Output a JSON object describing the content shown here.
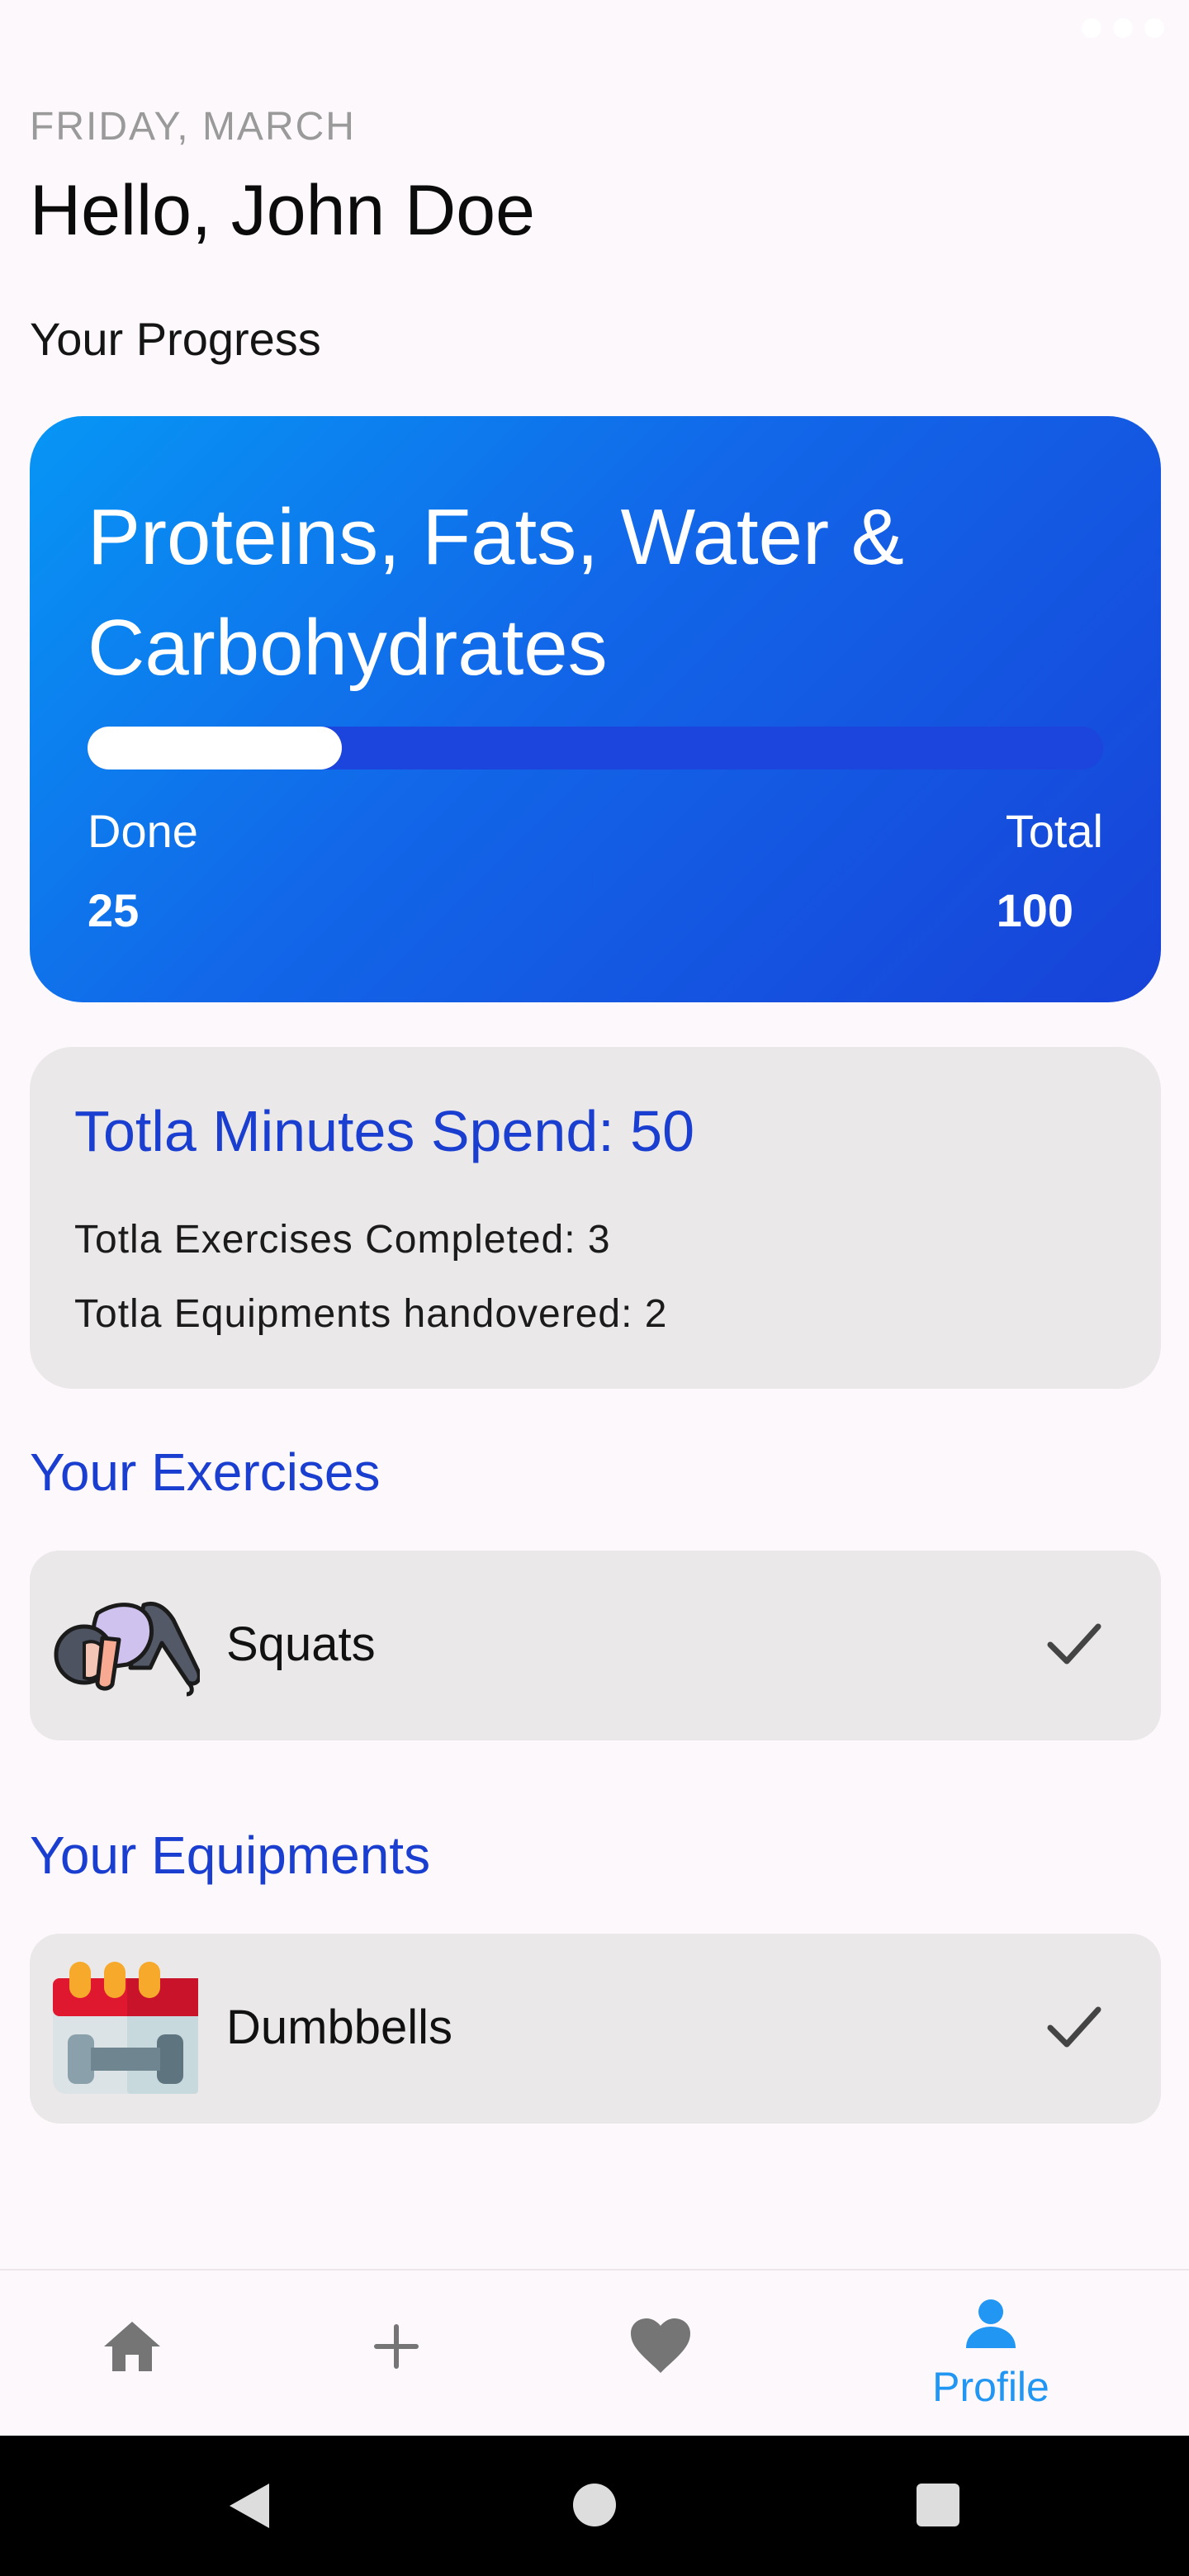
{
  "date_label": "FRIDAY, MARCH",
  "greeting": "Hello, John Doe",
  "progress_section_title": "Your Progress",
  "progress_card": {
    "title": "Proteins, Fats, Water & Carbohydrates",
    "done_label": "Done",
    "done_value": "25",
    "total_label": "Total",
    "total_value": "100",
    "progress_fraction": 0.25
  },
  "stats": {
    "minutes": "Totla Minutes Spend: 50",
    "exercises": "Totla Exercises Completed: 3",
    "equipments": "Totla Equipments handovered: 2"
  },
  "exercises_heading": "Your Exercises",
  "exercises": [
    {
      "label": "Squats",
      "icon": "stretching-person-icon",
      "status_icon": "check-icon"
    }
  ],
  "equipments_heading": "Your Equipments",
  "equipments": [
    {
      "label": "Dumbbells",
      "icon": "calendar-dumbbell-icon",
      "status_icon": "check-icon"
    }
  ],
  "bottom_nav": {
    "items": [
      {
        "icon": "home-icon"
      },
      {
        "icon": "plus-icon"
      },
      {
        "icon": "heart-icon"
      },
      {
        "icon": "person-icon",
        "label": "Profile",
        "active": true
      }
    ]
  },
  "colors": {
    "accent_blue": "#1a3fd0",
    "card_gradient_start": "#0796f5",
    "card_gradient_end": "#1742d8",
    "nav_active": "#2196f3",
    "nav_inactive": "#757575"
  }
}
